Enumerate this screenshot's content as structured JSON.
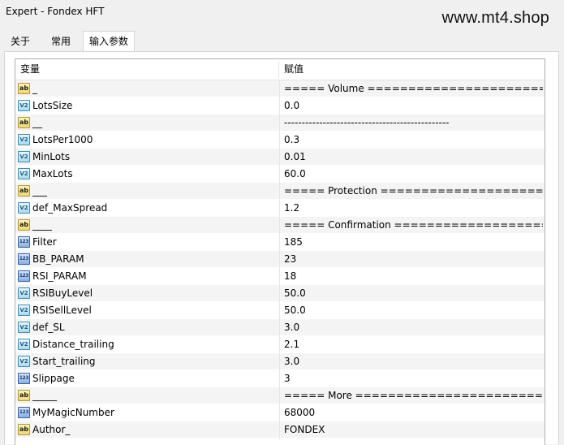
{
  "window": {
    "title": "Expert - Fondex HFT",
    "watermark": "www.mt4.shop"
  },
  "tabs": [
    {
      "label": "关于",
      "active": false
    },
    {
      "label": "常用",
      "active": false
    },
    {
      "label": "输入参数",
      "active": true
    }
  ],
  "grid": {
    "headers": {
      "variable": "变量",
      "value": "赋值"
    },
    "rows": [
      {
        "icon": "ab",
        "name": "_",
        "value": "===== Volume ========================..."
      },
      {
        "icon": "v2",
        "name": "LotsSize",
        "value": "0.0"
      },
      {
        "icon": "ab",
        "name": "__",
        "value": "-----------------------------------------------"
      },
      {
        "icon": "v2",
        "name": "LotsPer1000",
        "value": "0.3"
      },
      {
        "icon": "v2",
        "name": "MinLots",
        "value": "0.01"
      },
      {
        "icon": "v2",
        "name": "MaxLots",
        "value": "60.0"
      },
      {
        "icon": "ab",
        "name": "___",
        "value": "===== Protection ======================..."
      },
      {
        "icon": "v2",
        "name": "def_MaxSpread",
        "value": "1.2"
      },
      {
        "icon": "ab",
        "name": "____",
        "value": "===== Confirmation ====================..."
      },
      {
        "icon": "123",
        "name": "Filter",
        "value": "185"
      },
      {
        "icon": "123",
        "name": "BB_PARAM",
        "value": "23"
      },
      {
        "icon": "123",
        "name": "RSI_PARAM",
        "value": "18"
      },
      {
        "icon": "v2",
        "name": "RSIBuyLevel",
        "value": "50.0"
      },
      {
        "icon": "v2",
        "name": "RSISellLevel",
        "value": "50.0"
      },
      {
        "icon": "v2",
        "name": "def_SL",
        "value": "3.0"
      },
      {
        "icon": "v2",
        "name": "Distance_trailing",
        "value": "2.1"
      },
      {
        "icon": "v2",
        "name": "Start_trailing",
        "value": "3.0"
      },
      {
        "icon": "123",
        "name": "Slippage",
        "value": "3"
      },
      {
        "icon": "ab",
        "name": "_____",
        "value": "===== More ==========================..."
      },
      {
        "icon": "123",
        "name": "MyMagicNumber",
        "value": "68000"
      },
      {
        "icon": "ab",
        "name": "Author_",
        "value": "FONDEX"
      }
    ]
  },
  "icon_labels": {
    "ab": "ab",
    "v2": "V2",
    "123": "123"
  }
}
